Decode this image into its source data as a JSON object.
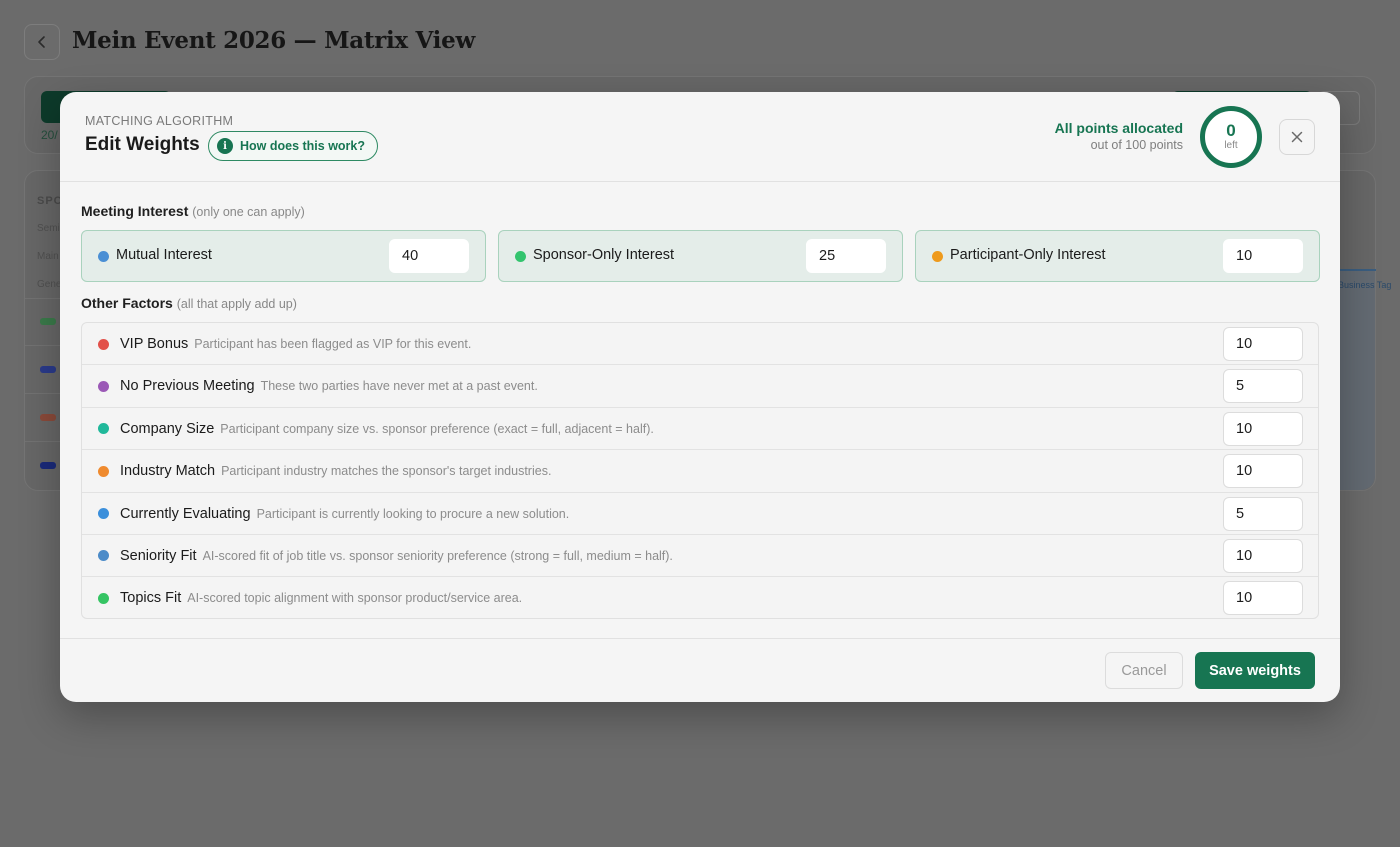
{
  "page": {
    "title": "Mein Event 2026 — Matrix View",
    "back_icon": "chevron-left-icon",
    "summary_fraction": "20/",
    "sponsors_heading": "SPO",
    "sponsor_labels": [
      "Semi",
      "Main",
      "Gene"
    ],
    "tag_label": "Business Tag"
  },
  "modal": {
    "eyebrow": "MATCHING ALGORITHM",
    "title": "Edit Weights",
    "help_label": "How does this work?",
    "help_icon": "info-icon",
    "allocation": {
      "status": "All points allocated",
      "subtitle": "out of 100 points",
      "left_value": "0",
      "left_label": "left"
    },
    "close_icon": "close-icon",
    "meeting_interest": {
      "title": "Meeting Interest",
      "note": "(only one can apply)",
      "items": [
        {
          "label": "Mutual Interest",
          "value": "40",
          "color": "#4a8fd4"
        },
        {
          "label": "Sponsor-Only Interest",
          "value": "25",
          "color": "#33c46e"
        },
        {
          "label": "Participant-Only Interest",
          "value": "10",
          "color": "#ee9a1c"
        }
      ]
    },
    "other_factors": {
      "title": "Other Factors",
      "note": "(all that apply add up)",
      "items": [
        {
          "label": "VIP Bonus",
          "description": "Participant has been flagged as VIP for this event.",
          "value": "10",
          "color": "#e2514a"
        },
        {
          "label": "No Previous Meeting",
          "description": "These two parties have never met at a past event.",
          "value": "5",
          "color": "#9b59b6"
        },
        {
          "label": "Company Size",
          "description": "Participant company size vs. sponsor preference (exact = full, adjacent = half).",
          "value": "10",
          "color": "#20b89a"
        },
        {
          "label": "Industry Match",
          "description": "Participant industry matches the sponsor's target industries.",
          "value": "10",
          "color": "#ef8a2e"
        },
        {
          "label": "Currently Evaluating",
          "description": "Participant is currently looking to procure a new solution.",
          "value": "5",
          "color": "#3b8fdb"
        },
        {
          "label": "Seniority Fit",
          "description": "AI-scored fit of job title vs. sponsor seniority preference (strong = full, medium = half).",
          "value": "10",
          "color": "#4c8bc8"
        },
        {
          "label": "Topics Fit",
          "description": "AI-scored topic alignment with sponsor product/service area.",
          "value": "10",
          "color": "#35c463"
        }
      ]
    },
    "footer": {
      "cancel_label": "Cancel",
      "save_label": "Save weights"
    },
    "accent_color": "#177552"
  }
}
